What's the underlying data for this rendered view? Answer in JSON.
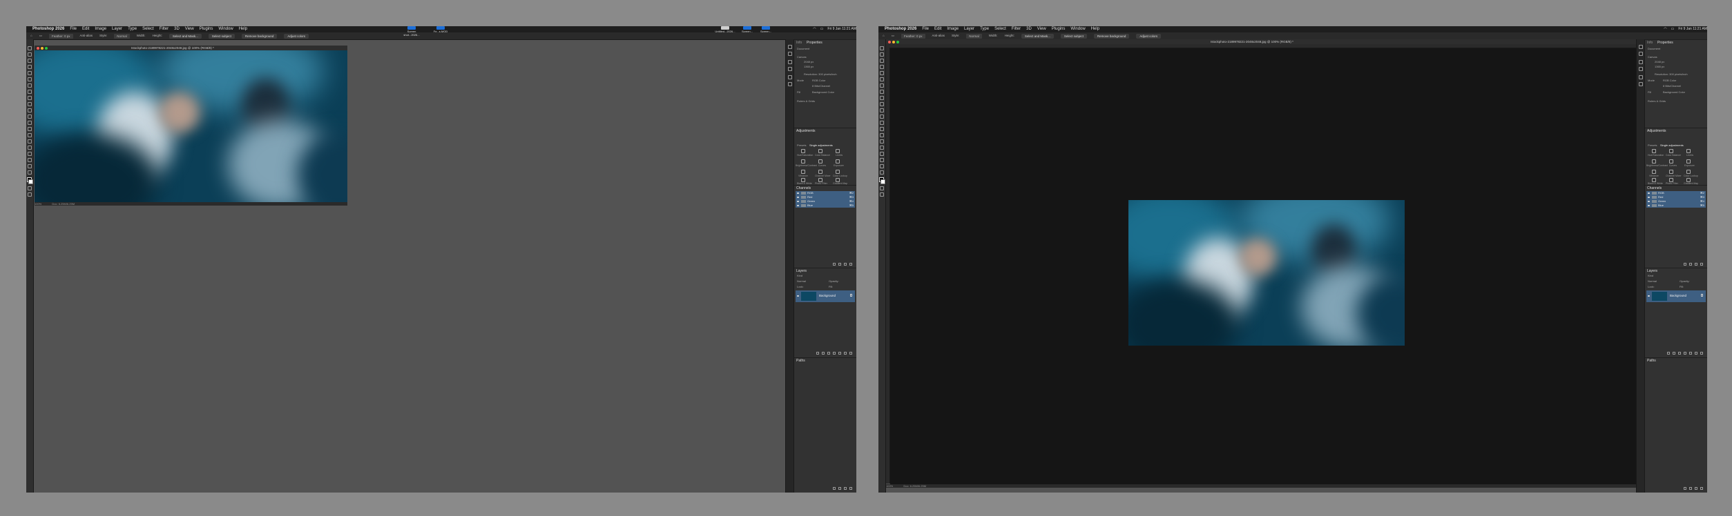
{
  "menubar": {
    "apple": "",
    "app_name": "Photoshop 2026",
    "menus": [
      "File",
      "Edit",
      "Image",
      "Layer",
      "Type",
      "Select",
      "Filter",
      "3D",
      "View",
      "Plugins",
      "Window",
      "Help"
    ],
    "status_left": "Fri 9 Jan  11:21 AM",
    "status_right": "Fri 9 Jan  11:21 AM"
  },
  "options_bar": {
    "feather": "Feather: 0 px",
    "antialias": "Anti-alias",
    "style_label": "Style:",
    "style_value": "Normal",
    "width_label": "Width:",
    "height_label": "Height:",
    "select_mask": "Select and Mask...",
    "select_subject": "Select subject",
    "remove_background": "Remove background",
    "adjust_colors": "Adjust colors"
  },
  "left_window": {
    "doc_title": "Istockphoto-2189978221-2048x2048.jpg @ 100% (RGB/8) *",
    "status_zoom": "100%",
    "status_doc": "Doc: 6.25M/6.25M",
    "thumbnails": [
      {
        "label": "Screen shot...2026...",
        "color": "#1d6fd8"
      },
      {
        "label": "Fe...s.MOD",
        "color": "#1d6fd8"
      },
      {
        "label": "Untitled...2026...",
        "color": "#cfcfcf"
      },
      {
        "label": "Screen...",
        "color": "#1d6fd8"
      },
      {
        "label": "Screen...",
        "color": "#1d6fd8"
      }
    ]
  },
  "right_window": {
    "doc_title": "Istockphoto-2189978221-2048x2048.jpg @ 100% (RGB/8) *",
    "status_zoom": "100%",
    "status_doc": "Doc: 6.25M/6.25M"
  },
  "properties_panel": {
    "tabs": [
      "Info",
      "Properties"
    ],
    "section": "Document",
    "canvas_label": "Canvas",
    "width": "2048 px",
    "height": "1365 px",
    "resolution": "Resolution: 300 pixels/inch",
    "mode_label": "Mode",
    "mode_value": "RGB Color",
    "depth_value": "8 Bits/Channel",
    "fill_label": "Fill",
    "fill_value": "Background Color",
    "rulers_grids": "Rulers & Grids"
  },
  "adjustments_panel": {
    "title": "Adjustments",
    "presets_label": "Presets",
    "single_label": "Single adjustments",
    "items": [
      "Hue/Saturation",
      "Color Balance",
      "Levels",
      "Brightness/Contrast",
      "Curves",
      "Exposure",
      "Vibrance",
      "Channel Mixer",
      "Color Lookup",
      "Black & White",
      "Photo Filter",
      "Gradient Map"
    ]
  },
  "channels_panel": {
    "title": "Channels",
    "rows": [
      {
        "name": "RGB",
        "shortcut": "⌘2"
      },
      {
        "name": "Red",
        "shortcut": "⌘3"
      },
      {
        "name": "Green",
        "shortcut": "⌘4"
      },
      {
        "name": "Blue",
        "shortcut": "⌘5"
      }
    ]
  },
  "layers_panel": {
    "title": "Layers",
    "kind_label": "Kind",
    "blend_mode": "Normal",
    "opacity_label": "Opacity:",
    "fill_label": "Fill:",
    "lock_label": "Lock:",
    "layer_name": "Background"
  },
  "paths_panel": {
    "title": "Paths"
  },
  "colors": {
    "menubar": "#1e1e1e",
    "panel": "#2d2d2d",
    "selection": "#3e5f82",
    "canvas_bg_left": "#535353",
    "canvas_bg_right": "#151515",
    "photo_teal": "#0b3f57",
    "dot_red": "#ff5f57",
    "dot_yellow": "#febc2e",
    "dot_green": "#28c840"
  }
}
